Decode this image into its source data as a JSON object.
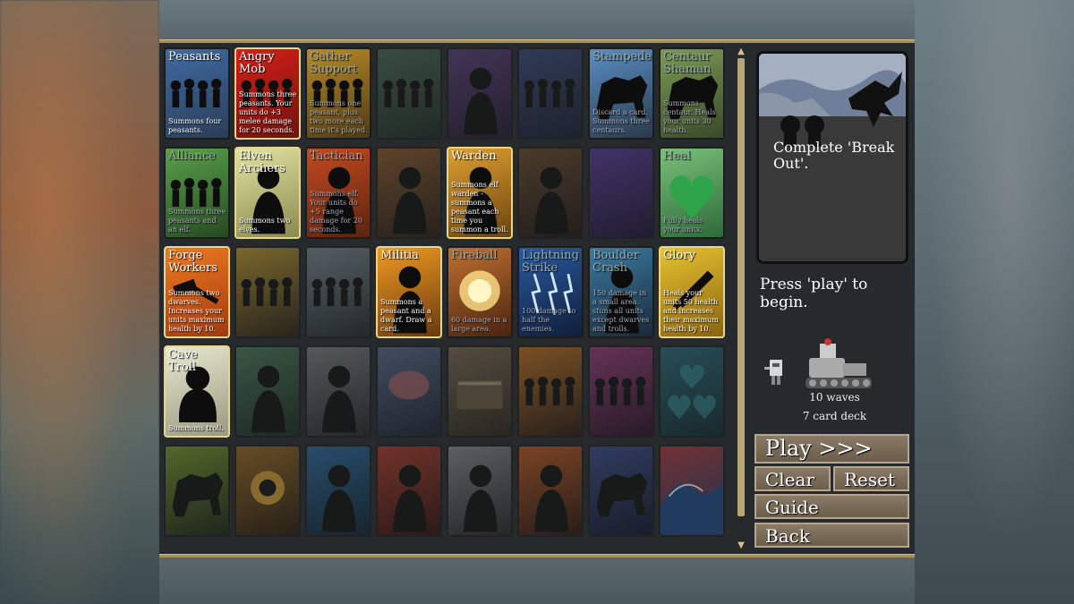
{
  "cards": [
    {
      "title": "Peasants",
      "desc": "Summons four peasants.",
      "row": 0,
      "col": 0,
      "owned": false,
      "bg": "#3f6aa3",
      "bg2": "#2b3e58",
      "art": "people",
      "locked": false
    },
    {
      "title": "Angry Mob",
      "desc": "Summons three peasants. Your units do +3 melee damage for 20 seconds.",
      "row": 0,
      "col": 1,
      "owned": true,
      "bg": "#d51f17",
      "bg2": "#6e1410",
      "art": "people",
      "locked": false
    },
    {
      "title": "Gather Support",
      "desc": "Summons one peasant, plus two more each time it's played.",
      "row": 0,
      "col": 2,
      "owned": false,
      "bg": "#b78a24",
      "bg2": "#4e3b18",
      "art": "people",
      "locked": false,
      "dim": true
    },
    {
      "title": "",
      "desc": "",
      "row": 0,
      "col": 3,
      "owned": false,
      "bg": "#4a6a54",
      "bg2": "#1d2a22",
      "art": "people",
      "locked": true
    },
    {
      "title": "",
      "desc": "",
      "row": 0,
      "col": 4,
      "owned": false,
      "bg": "#5a3e7a",
      "bg2": "#241830",
      "art": "figure",
      "locked": true
    },
    {
      "title": "",
      "desc": "",
      "row": 0,
      "col": 5,
      "owned": false,
      "bg": "#3c4a7a",
      "bg2": "#161c30",
      "art": "people",
      "locked": true
    },
    {
      "title": "Stampede",
      "desc": "Discard a card. Summons three centaurs.",
      "row": 0,
      "col": 6,
      "owned": false,
      "bg": "#5a8ec4",
      "bg2": "#2a3a4a",
      "art": "beast",
      "locked": false,
      "dim": true
    },
    {
      "title": "Centaur Shaman",
      "desc": "Summons centaur. Heals your units 30 health.",
      "row": 0,
      "col": 7,
      "owned": false,
      "bg": "#7a9a54",
      "bg2": "#3a4a2a",
      "art": "beast",
      "locked": false,
      "dim": true
    },
    {
      "title": "Alliance",
      "desc": "Summons three peasants and an elf.",
      "row": 1,
      "col": 0,
      "owned": false,
      "bg": "#5aa04a",
      "bg2": "#264a22",
      "art": "people",
      "locked": false,
      "dim": true
    },
    {
      "title": "Elven Archers",
      "desc": "Summons two elves.",
      "row": 1,
      "col": 1,
      "owned": true,
      "bg": "#e2e2a0",
      "bg2": "#8a8a50",
      "art": "figure",
      "locked": false
    },
    {
      "title": "Tactician",
      "desc": "Summons elf. Your units do +5 range damage for 20 seconds.",
      "row": 1,
      "col": 2,
      "owned": false,
      "bg": "#c44a20",
      "bg2": "#5a2410",
      "art": "figure",
      "locked": false,
      "dim": true
    },
    {
      "title": "",
      "desc": "",
      "row": 1,
      "col": 3,
      "owned": false,
      "bg": "#8a5a2a",
      "bg2": "#2a1a10",
      "art": "figure",
      "locked": true
    },
    {
      "title": "Warden",
      "desc": "Summons elf warden - summons a peasant each time you summon a troll.",
      "row": 1,
      "col": 4,
      "owned": true,
      "bg": "#e0a030",
      "bg2": "#6a4410",
      "art": "figure",
      "locked": false
    },
    {
      "title": "",
      "desc": "",
      "row": 1,
      "col": 5,
      "owned": false,
      "bg": "#6a4a2a",
      "bg2": "#201410",
      "art": "figure",
      "locked": true
    },
    {
      "title": "",
      "desc": "",
      "row": 1,
      "col": 6,
      "owned": false,
      "bg": "#5a3a9a",
      "bg2": "#1e1434",
      "art": "none",
      "locked": true
    },
    {
      "title": "Heal",
      "desc": "Fully heals your units.",
      "row": 1,
      "col": 7,
      "owned": false,
      "bg": "#7ac07a",
      "bg2": "#2e6a3a",
      "art": "heart",
      "locked": false,
      "dim": true
    },
    {
      "title": "Forge Workers",
      "desc": "Summons two dwarves. Increases your units maximum health by 10.",
      "row": 2,
      "col": 0,
      "owned": true,
      "bg": "#f07a20",
      "bg2": "#a03a10",
      "art": "hammer",
      "locked": false
    },
    {
      "title": "",
      "desc": "",
      "row": 2,
      "col": 1,
      "owned": false,
      "bg": "#c09a30",
      "bg2": "#2a2010",
      "art": "people",
      "locked": true
    },
    {
      "title": "",
      "desc": "",
      "row": 2,
      "col": 2,
      "owned": false,
      "bg": "#7a8a90",
      "bg2": "#242a2c",
      "art": "people",
      "locked": true
    },
    {
      "title": "Militia",
      "desc": "Summons a peasant and a dwarf. Draw a card.",
      "row": 2,
      "col": 3,
      "owned": true,
      "bg": "#f09a20",
      "bg2": "#6a3a10",
      "art": "figure",
      "locked": false
    },
    {
      "title": "Fireball",
      "desc": "60 damage in a large area.",
      "row": 2,
      "col": 4,
      "owned": false,
      "bg": "#c07030",
      "bg2": "#4a2410",
      "art": "fire",
      "locked": false,
      "dim": true
    },
    {
      "title": "Lightning Strike",
      "desc": "100 damage to half the enemies.",
      "row": 2,
      "col": 5,
      "owned": false,
      "bg": "#2a5aa0",
      "bg2": "#101e3a",
      "art": "bolt",
      "locked": false,
      "dim": true
    },
    {
      "title": "Boulder Crash",
      "desc": "150 damage in a small area. stuns all units except dwarves and trolls.",
      "row": 2,
      "col": 6,
      "owned": false,
      "bg": "#3a7aa0",
      "bg2": "#1a2a3a",
      "art": "figure",
      "locked": false,
      "dim": true
    },
    {
      "title": "Glory",
      "desc": "Heals your units 50 health and increases their maximum health by 10.",
      "row": 2,
      "col": 7,
      "owned": true,
      "bg": "#e6c230",
      "bg2": "#8a6410",
      "art": "sword",
      "locked": false
    },
    {
      "title": "Cave Troll",
      "desc": "Summons troll.",
      "row": 3,
      "col": 0,
      "owned": true,
      "bg": "#e8e8d0",
      "bg2": "#9a9a80",
      "art": "troll",
      "locked": false
    },
    {
      "title": "",
      "desc": "",
      "row": 3,
      "col": 1,
      "owned": false,
      "bg": "#4a7a5a",
      "bg2": "#1a2a20",
      "art": "figure",
      "locked": true
    },
    {
      "title": "",
      "desc": "",
      "row": 3,
      "col": 2,
      "owned": false,
      "bg": "#7a8084",
      "bg2": "#242628",
      "art": "figure",
      "locked": true
    },
    {
      "title": "",
      "desc": "",
      "row": 3,
      "col": 3,
      "owned": false,
      "bg": "#5a6a8a",
      "bg2": "#1a2030",
      "art": "brain",
      "locked": true
    },
    {
      "title": "",
      "desc": "",
      "row": 3,
      "col": 4,
      "owned": false,
      "bg": "#7a6a50",
      "bg2": "#2a2418",
      "art": "book",
      "locked": true
    },
    {
      "title": "",
      "desc": "",
      "row": 3,
      "col": 5,
      "owned": false,
      "bg": "#c07020",
      "bg2": "#2a1a10",
      "art": "people",
      "locked": true
    },
    {
      "title": "",
      "desc": "",
      "row": 3,
      "col": 6,
      "owned": false,
      "bg": "#9a3a7a",
      "bg2": "#2a1024",
      "art": "people",
      "locked": true
    },
    {
      "title": "",
      "desc": "",
      "row": 3,
      "col": 7,
      "owned": false,
      "bg": "#2a6a7a",
      "bg2": "#0e2a30",
      "art": "hearts",
      "locked": true
    },
    {
      "title": "",
      "desc": "",
      "row": 4,
      "col": 0,
      "owned": false,
      "bg": "#7a9a2a",
      "bg2": "#1a2410",
      "art": "beast",
      "locked": true
    },
    {
      "title": "",
      "desc": "",
      "row": 4,
      "col": 1,
      "owned": false,
      "bg": "#9a6a20",
      "bg2": "#2a1a08",
      "art": "eye",
      "locked": true
    },
    {
      "title": "",
      "desc": "",
      "row": 4,
      "col": 2,
      "owned": false,
      "bg": "#2a6aa0",
      "bg2": "#0e2030",
      "art": "figure",
      "locked": true
    },
    {
      "title": "",
      "desc": "",
      "row": 4,
      "col": 3,
      "owned": false,
      "bg": "#b03a2a",
      "bg2": "#300e0a",
      "art": "figure",
      "locked": true
    },
    {
      "title": "",
      "desc": "",
      "row": 4,
      "col": 4,
      "owned": false,
      "bg": "#8a8a8a",
      "bg2": "#242424",
      "art": "figure",
      "locked": true
    },
    {
      "title": "",
      "desc": "",
      "row": 4,
      "col": 5,
      "owned": false,
      "bg": "#c05a20",
      "bg2": "#2a140a",
      "art": "figure",
      "locked": true
    },
    {
      "title": "",
      "desc": "",
      "row": 4,
      "col": 6,
      "owned": false,
      "bg": "#3a4a8a",
      "bg2": "#10142a",
      "art": "beast",
      "locked": true
    },
    {
      "title": "",
      "desc": "",
      "row": 4,
      "col": 7,
      "owned": false,
      "bg": "#b03a3a",
      "bg2": "#1a3a6a",
      "art": "wave",
      "locked": true
    }
  ],
  "preview": {
    "text": "Complete 'Break Out'."
  },
  "hint": "Press 'play' to begin.",
  "info": {
    "waves": "10 waves",
    "deck": "7 card deck"
  },
  "buttons": {
    "play": "Play >>>",
    "clear": "Clear",
    "reset": "Reset",
    "guide": "Guide",
    "back": "Back"
  },
  "colors": {
    "gold": "#a88f5a",
    "panel": "#262a2c",
    "button": "#7a6b58"
  }
}
